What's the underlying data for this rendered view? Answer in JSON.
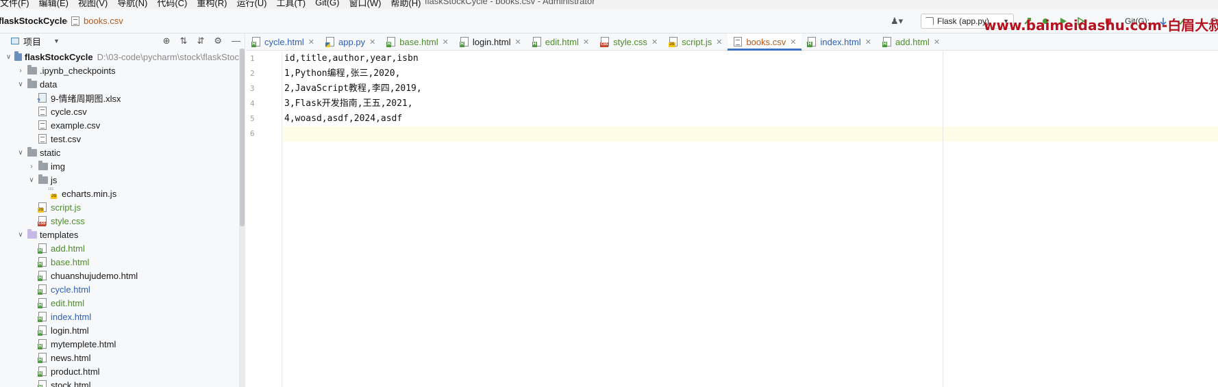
{
  "menu": {
    "items": [
      "文件(F)",
      "编辑(E)",
      "视图(V)",
      "导航(N)",
      "代码(C)",
      "重构(R)",
      "运行(U)",
      "工具(T)",
      "Git(G)",
      "窗口(W)",
      "帮助(H)"
    ],
    "window_title": "flaskStockCycle - books.csv - Administrator"
  },
  "navbar": {
    "project": "flaskStockCycle",
    "separator": "›",
    "file": "books.csv",
    "run_config": "Flask (app.py)",
    "git_label": "Git(G):",
    "watermark": "www.baimeidashu.com-白眉大叔"
  },
  "project_panel": {
    "title": "项目",
    "tree": [
      {
        "label": "flaskStockCycle",
        "detail": "D:\\03-code\\pycharm\\stock\\flaskStoc",
        "indent": 0,
        "chev": "v",
        "type": "folder-blue",
        "style": "bold"
      },
      {
        "label": ".ipynb_checkpoints",
        "indent": 1,
        "chev": ">",
        "type": "folder"
      },
      {
        "label": "data",
        "indent": 1,
        "chev": "v",
        "type": "folder"
      },
      {
        "label": "9-情绪周期图.xlsx",
        "indent": 2,
        "chev": "",
        "type": "xlsx"
      },
      {
        "label": "cycle.csv",
        "indent": 2,
        "chev": "",
        "type": "csv"
      },
      {
        "label": "example.csv",
        "indent": 2,
        "chev": "",
        "type": "csv"
      },
      {
        "label": "test.csv",
        "indent": 2,
        "chev": "",
        "type": "csv"
      },
      {
        "label": "static",
        "indent": 1,
        "chev": "v",
        "type": "folder"
      },
      {
        "label": "img",
        "indent": 2,
        "chev": ">",
        "type": "folder"
      },
      {
        "label": "js",
        "indent": 2,
        "chev": "v",
        "type": "folder"
      },
      {
        "label": "echarts.min.js",
        "indent": 3,
        "chev": "",
        "type": "minjs"
      },
      {
        "label": "script.js",
        "indent": 2,
        "chev": "",
        "type": "js",
        "style": "green"
      },
      {
        "label": "style.css",
        "indent": 2,
        "chev": "",
        "type": "css",
        "style": "green"
      },
      {
        "label": "templates",
        "indent": 1,
        "chev": "v",
        "type": "folder-purple"
      },
      {
        "label": "add.html",
        "indent": 2,
        "chev": "",
        "type": "html",
        "style": "green"
      },
      {
        "label": "base.html",
        "indent": 2,
        "chev": "",
        "type": "html",
        "style": "green"
      },
      {
        "label": "chuanshujudemo.html",
        "indent": 2,
        "chev": "",
        "type": "html"
      },
      {
        "label": "cycle.html",
        "indent": 2,
        "chev": "",
        "type": "html",
        "style": "blue"
      },
      {
        "label": "edit.html",
        "indent": 2,
        "chev": "",
        "type": "html",
        "style": "green"
      },
      {
        "label": "index.html",
        "indent": 2,
        "chev": "",
        "type": "html",
        "style": "blue"
      },
      {
        "label": "login.html",
        "indent": 2,
        "chev": "",
        "type": "html"
      },
      {
        "label": "mytemplete.html",
        "indent": 2,
        "chev": "",
        "type": "html"
      },
      {
        "label": "news.html",
        "indent": 2,
        "chev": "",
        "type": "html"
      },
      {
        "label": "product.html",
        "indent": 2,
        "chev": "",
        "type": "html"
      },
      {
        "label": "stock.html",
        "indent": 2,
        "chev": "",
        "type": "html"
      }
    ]
  },
  "tabs": [
    {
      "label": "cycle.html",
      "type": "html",
      "style": "blue",
      "active": false
    },
    {
      "label": "app.py",
      "type": "py",
      "style": "blue",
      "active": false
    },
    {
      "label": "base.html",
      "type": "html",
      "style": "green",
      "active": false
    },
    {
      "label": "login.html",
      "type": "html",
      "style": "",
      "active": false
    },
    {
      "label": "edit.html",
      "type": "html",
      "style": "green",
      "active": false
    },
    {
      "label": "style.css",
      "type": "css",
      "style": "green",
      "active": false
    },
    {
      "label": "script.js",
      "type": "js",
      "style": "green",
      "active": false
    },
    {
      "label": "books.csv",
      "type": "csv",
      "style": "orange",
      "active": true
    },
    {
      "label": "index.html",
      "type": "html",
      "style": "blue",
      "active": false
    },
    {
      "label": "add.html",
      "type": "html",
      "style": "green",
      "active": false
    }
  ],
  "editor": {
    "lines": [
      "id,title,author,year,isbn",
      "1,Python编程,张三,2020,",
      "2,JavaScript教程,李四,2019,",
      "3,Flask开发指南,王五,2021,",
      "4,woasd,asdf,2024,asdf",
      ""
    ],
    "current_line": 6
  },
  "colors": {
    "accent": "#3d72c4",
    "green_file": "#4d8a2a",
    "blue_file": "#2d5fb8",
    "orange_file": "#b5581a",
    "watermark": "#b5111e"
  }
}
